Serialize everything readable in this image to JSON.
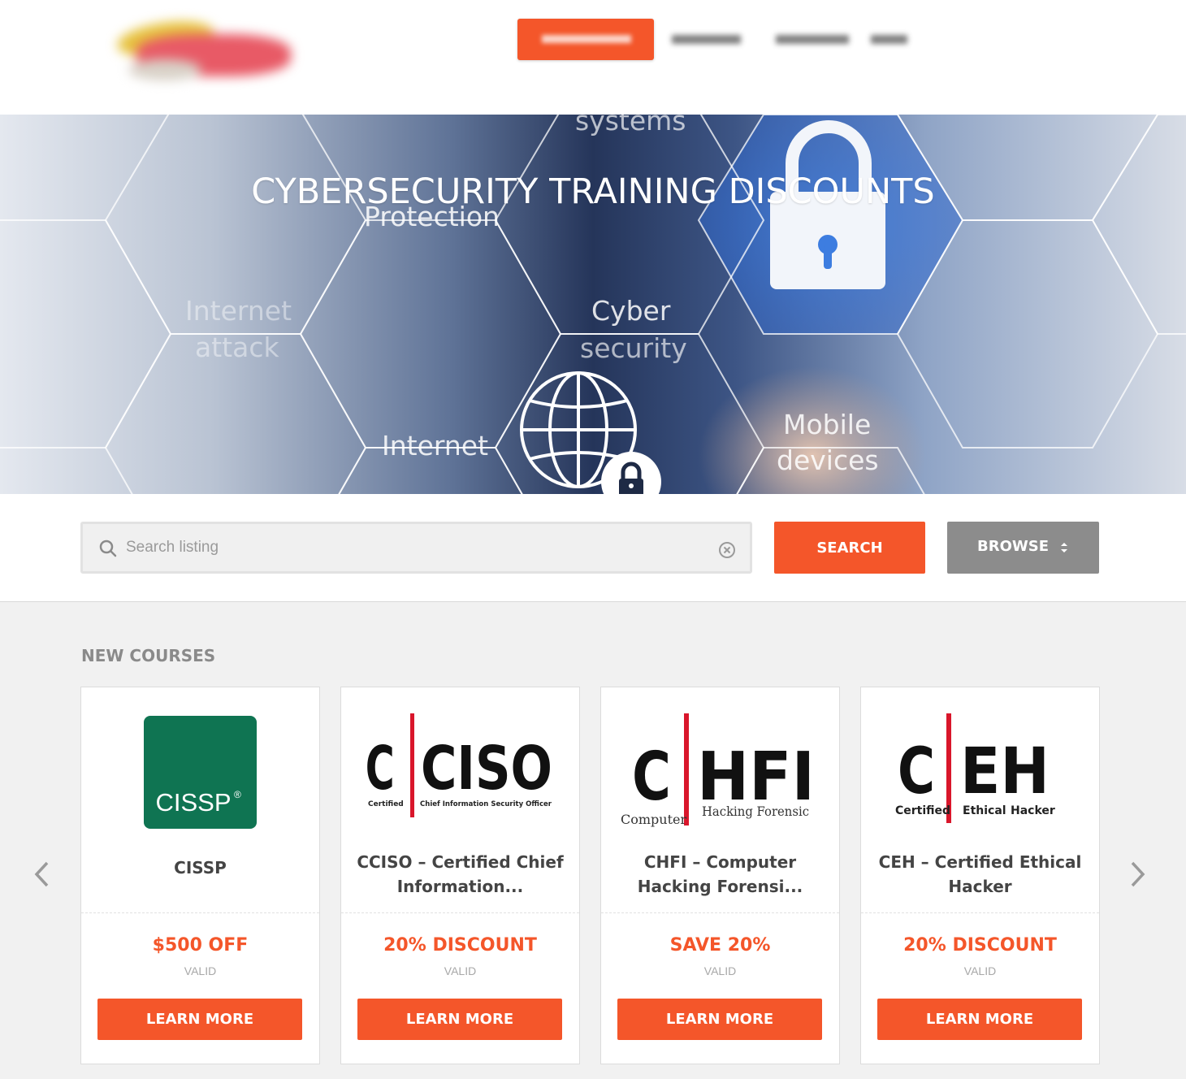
{
  "hero": {
    "title": "CYBERSECURITY TRAINING DISCOUNTS",
    "background_words": [
      "systems",
      "Protection",
      "Internet",
      "attack",
      "Cyber",
      "security",
      "Internet",
      "Mobile",
      "devices"
    ]
  },
  "search": {
    "placeholder": "Search listing",
    "value": "",
    "search_label": "SEARCH",
    "browse_label": "BROWSE"
  },
  "courses": {
    "heading": "NEW COURSES",
    "items": [
      {
        "logo_text": "CISSP",
        "logo_mark": "®",
        "title": "CISSP",
        "offer": "$500 OFF",
        "valid": "VALID",
        "button": "LEARN MORE"
      },
      {
        "logo_text": "C|CISO",
        "logo_sub": [
          "Certified",
          "Chief Information Security Officer"
        ],
        "title": "CCISO – Certified Chief Information...",
        "offer": "20% DISCOUNT",
        "valid": "VALID",
        "button": "LEARN MORE"
      },
      {
        "logo_text": "C|HFI",
        "logo_sub": [
          "Computer",
          "Hacking Forensic"
        ],
        "title": "CHFI – Computer Hacking Forensi...",
        "offer": "SAVE 20%",
        "valid": "VALID",
        "button": "LEARN MORE"
      },
      {
        "logo_text": "C|EH",
        "logo_sub": [
          "Certified",
          "Ethical",
          "Hacker"
        ],
        "title": "CEH – Certified Ethical Hacker",
        "offer": "20% DISCOUNT",
        "valid": "VALID",
        "button": "LEARN MORE"
      }
    ]
  },
  "colors": {
    "accent": "#f4562a",
    "browse": "#8c8c8c",
    "cissp_green": "#0f7452",
    "eccouncil_red": "#d9162b"
  },
  "icons": {
    "search": "search-icon",
    "clear": "clear-icon",
    "sort": "sort-icon",
    "prev": "chevron-left-icon",
    "next": "chevron-right-icon",
    "hero_lock": "padlock-icon",
    "hero_globe": "globe-icon"
  }
}
